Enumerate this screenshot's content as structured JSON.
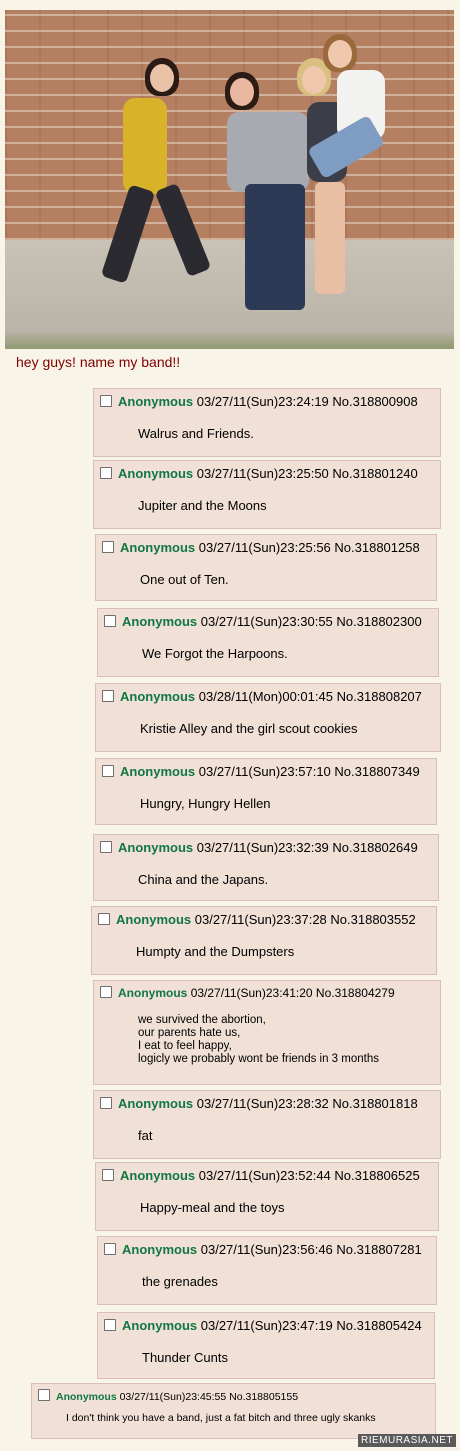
{
  "thread": {
    "subject": "hey guys! name my band!!"
  },
  "photo": {
    "description_icon": "photo-icon"
  },
  "posts": [
    {
      "name": "Anonymous",
      "date": "03/27/11(Sun)23:24:19",
      "no": "No.318800908",
      "text": "Walrus and Friends."
    },
    {
      "name": "Anonymous",
      "date": "03/27/11(Sun)23:25:50",
      "no": "No.318801240",
      "text": "Jupiter and the Moons"
    },
    {
      "name": "Anonymous",
      "date": "03/27/11(Sun)23:25:56",
      "no": "No.318801258",
      "text": "One out of Ten."
    },
    {
      "name": "Anonymous",
      "date": "03/27/11(Sun)23:30:55",
      "no": "No.318802300",
      "text": "We Forgot the Harpoons."
    },
    {
      "name": "Anonymous",
      "date": "03/28/11(Mon)00:01:45",
      "no": "No.318808207",
      "text": "Kristie Alley and the girl scout cookies"
    },
    {
      "name": "Anonymous",
      "date": "03/27/11(Sun)23:57:10",
      "no": "No.318807349",
      "text": "Hungry, Hungry Hellen"
    },
    {
      "name": "Anonymous",
      "date": "03/27/11(Sun)23:32:39",
      "no": "No.318802649",
      "text": "China and the Japans."
    },
    {
      "name": "Anonymous",
      "date": "03/27/11(Sun)23:37:28",
      "no": "No.318803552",
      "text": "Humpty and the Dumpsters"
    },
    {
      "name": "Anonymous",
      "date": "03/27/11(Sun)23:41:20",
      "no": "No.318804279",
      "text": "we survived the abortion,\nour parents hate us,\nI eat to feel happy,\nlogicly we probably wont be friends in 3 months"
    },
    {
      "name": "Anonymous",
      "date": "03/27/11(Sun)23:28:32",
      "no": "No.318801818",
      "text": "fat"
    },
    {
      "name": "Anonymous",
      "date": "03/27/11(Sun)23:52:44",
      "no": "No.318806525",
      "text": "Happy-meal and the toys"
    },
    {
      "name": "Anonymous",
      "date": "03/27/11(Sun)23:56:46",
      "no": "No.318807281",
      "text": "the grenades"
    },
    {
      "name": "Anonymous",
      "date": "03/27/11(Sun)23:47:19",
      "no": "No.318805424",
      "text": "Thunder Cunts"
    },
    {
      "name": "Anonymous",
      "date": "03/27/11(Sun)23:45:55",
      "no": "No.318805155",
      "text": "I don't think you have a band, just a fat bitch and three ugly skanks"
    }
  ],
  "watermark": "RIEMURASIA.NET",
  "colors": {
    "name_green": "#117743",
    "post_bg": "#f0e0d6",
    "subject_red": "#800000",
    "page_bg": "#f8f5e8"
  }
}
